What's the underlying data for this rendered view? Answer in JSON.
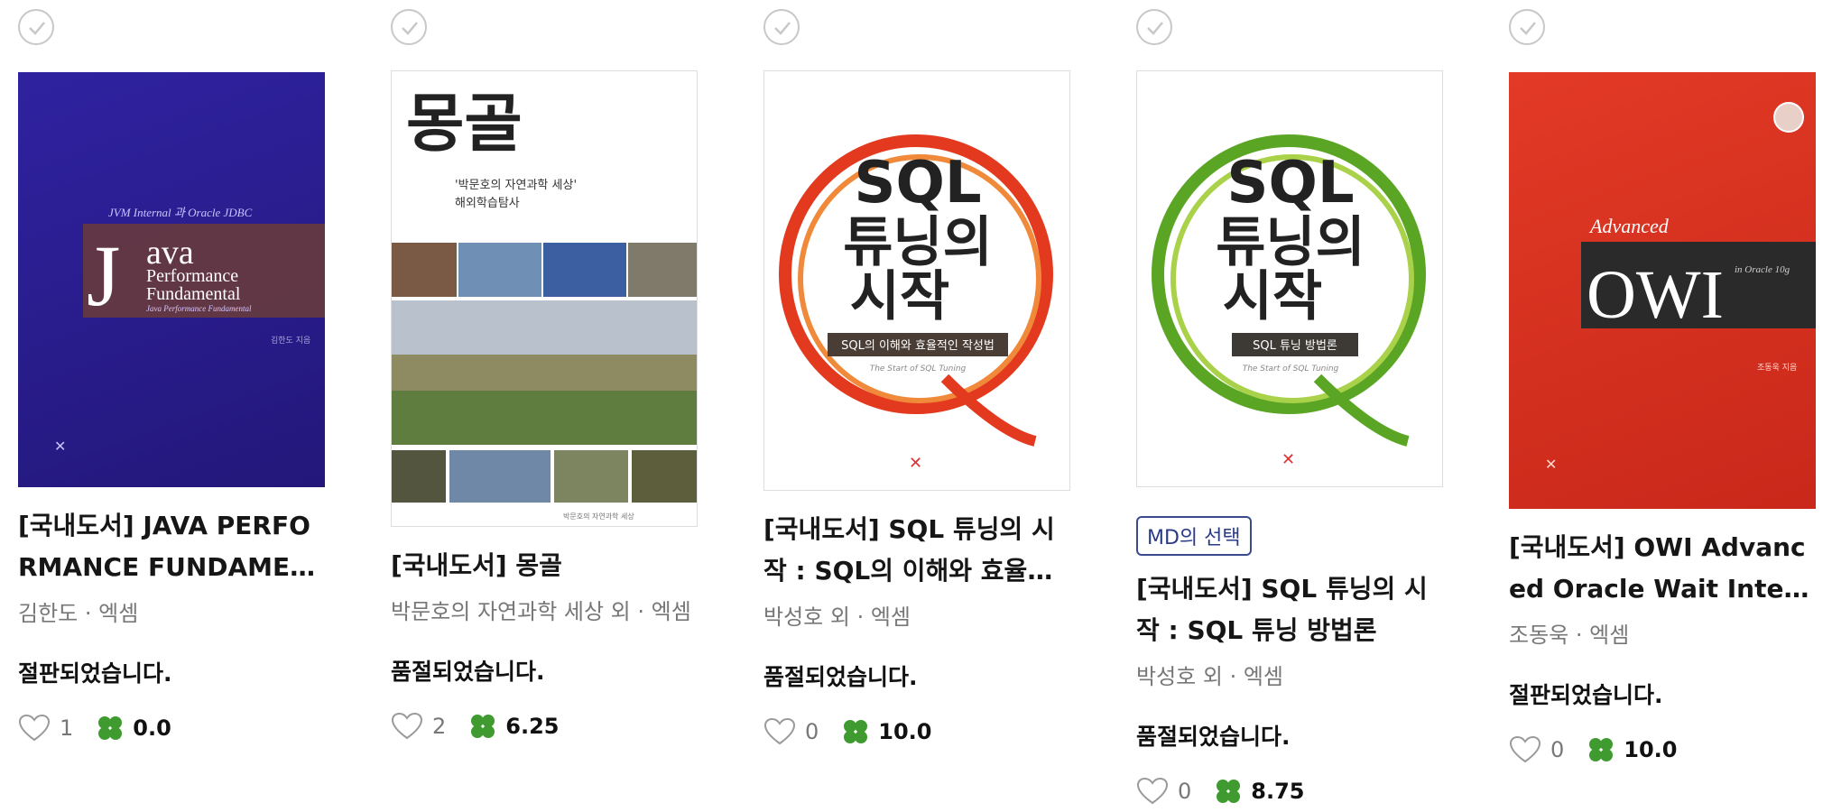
{
  "books": [
    {
      "title": "[국내도서] JAVA PERFORMANCE FUNDAMENTAL",
      "author": "김한도 · 엑셈",
      "status": "절판되었습니다.",
      "likes": "1",
      "rating": "0.0",
      "cover": {
        "top_text": "JVM Internal 과 Oracle JDBC",
        "big_letter": "J",
        "line1": "ava",
        "line2": "Performance",
        "line3": "Fundamental",
        "sub": "Java Performance Fundamental",
        "author": "김한도 지음"
      }
    },
    {
      "title": "[국내도서] 몽골",
      "author": "박문호의 자연과학 세상 외 · 엑셈",
      "status": "품절되었습니다.",
      "likes": "2",
      "rating": "6.25",
      "cover": {
        "big_title": "몽골",
        "sub1": "'박문호의 자연과학 세상'",
        "sub2": "해외학습탐사",
        "footer": "박문호의 자연과학 세상"
      }
    },
    {
      "title": "[국내도서] SQL 튜닝의 시작 : SQL의 이해와 효율적...",
      "author": "박성호 외 · 엑셈",
      "status": "품절되었습니다.",
      "likes": "0",
      "rating": "10.0",
      "cover": {
        "line1": "SQL",
        "line2": "튜닝의",
        "line3": "시작",
        "band": "SQL의 이해와 효율적인 작성법",
        "sub": "The Start of SQL Tuning"
      }
    },
    {
      "badge": "MD의 선택",
      "title": "[국내도서] SQL 튜닝의 시작 : SQL 튜닝 방법론",
      "author": "박성호 외 · 엑셈",
      "status": "품절되었습니다.",
      "likes": "0",
      "rating": "8.75",
      "cover": {
        "line1": "SQL",
        "line2": "튜닝의",
        "line3": "시작",
        "band": "SQL 튜닝 방법론",
        "sub": "The Start of SQL Tuning"
      }
    },
    {
      "title": "[국내도서] OWI Advanced Oracle Wait Interface in ...",
      "author": "조동욱 · 엑셈",
      "status": "절판되었습니다.",
      "likes": "0",
      "rating": "10.0",
      "cover": {
        "advanced": "Advanced",
        "owi": "OWI",
        "in": "in Oracle 10g",
        "author": "조동욱 지음"
      }
    }
  ],
  "colors": {
    "clover": "#3f9b2f",
    "badge": "#2a3b86",
    "java_cover": "#2b1d8a",
    "owi_cover": "#d9301f"
  }
}
